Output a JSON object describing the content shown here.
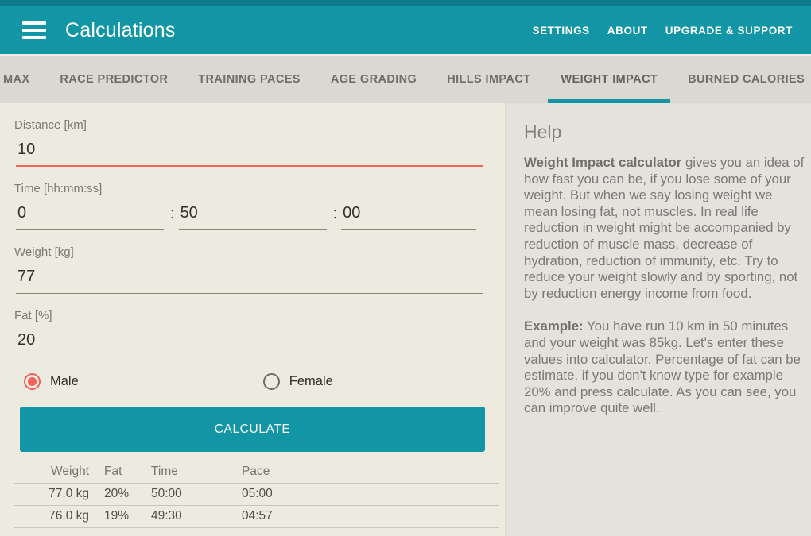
{
  "header": {
    "title": "Calculations",
    "actions": [
      {
        "label": "SETTINGS"
      },
      {
        "label": "ABOUT"
      },
      {
        "label": "UPGRADE & SUPPORT"
      }
    ]
  },
  "tabs": {
    "items": [
      {
        "label": "MAX"
      },
      {
        "label": "RACE PREDICTOR"
      },
      {
        "label": "TRAINING PACES"
      },
      {
        "label": "AGE GRADING"
      },
      {
        "label": "HILLS IMPACT"
      },
      {
        "label": "WEIGHT IMPACT"
      },
      {
        "label": "BURNED CALORIES"
      }
    ],
    "active": "WEIGHT IMPACT"
  },
  "form": {
    "distance": {
      "label": "Distance [km]",
      "value": "10"
    },
    "time": {
      "label": "Time [hh:mm:ss]",
      "hours": "0",
      "minutes": "50",
      "seconds": "00",
      "separator": ":"
    },
    "weight": {
      "label": "Weight [kg]",
      "value": "77"
    },
    "fat": {
      "label": "Fat [%]",
      "value": "20"
    },
    "gender": {
      "options": [
        {
          "label": "Male",
          "selected": true
        },
        {
          "label": "Female",
          "selected": false
        }
      ]
    },
    "calculate_label": "CALCULATE"
  },
  "results": {
    "columns": [
      "Weight",
      "Fat",
      "Time",
      "Pace"
    ],
    "rows": [
      [
        "77.0 kg",
        "20%",
        "50:00",
        "05:00"
      ],
      [
        "76.0 kg",
        "19%",
        "49:30",
        "04:57"
      ]
    ]
  },
  "help": {
    "title": "Help",
    "p1_bold": "Weight Impact calculator",
    "p1_rest": " gives you an idea of how fast you can be, if you lose some of your weight. But when we say losing weight we mean losing fat, not muscles. In real life reduction in weight might be accompanied by reduction of muscle mass, decrease of hydration, reduction of immunity, etc. Try to reduce your weight slowly and by sporting, not by reduction energy income from food.",
    "p2_bold": "Example:",
    "p2_rest": " You have run 10 km in 50 minutes and your weight was 85kg. Let's enter these values into calculator. Percentage of fat can be estimate, if you don't know type for example 20% and press calculate. As you can see, you can improve quite well."
  },
  "colors": {
    "accent_teal": "#1295a4",
    "statusbar_teal": "#0b7c8b",
    "focus_red": "#f2615a",
    "form_bg": "#edebdf",
    "help_bg": "#e3e2dd",
    "tabbar_bg": "#d9d8d1"
  }
}
